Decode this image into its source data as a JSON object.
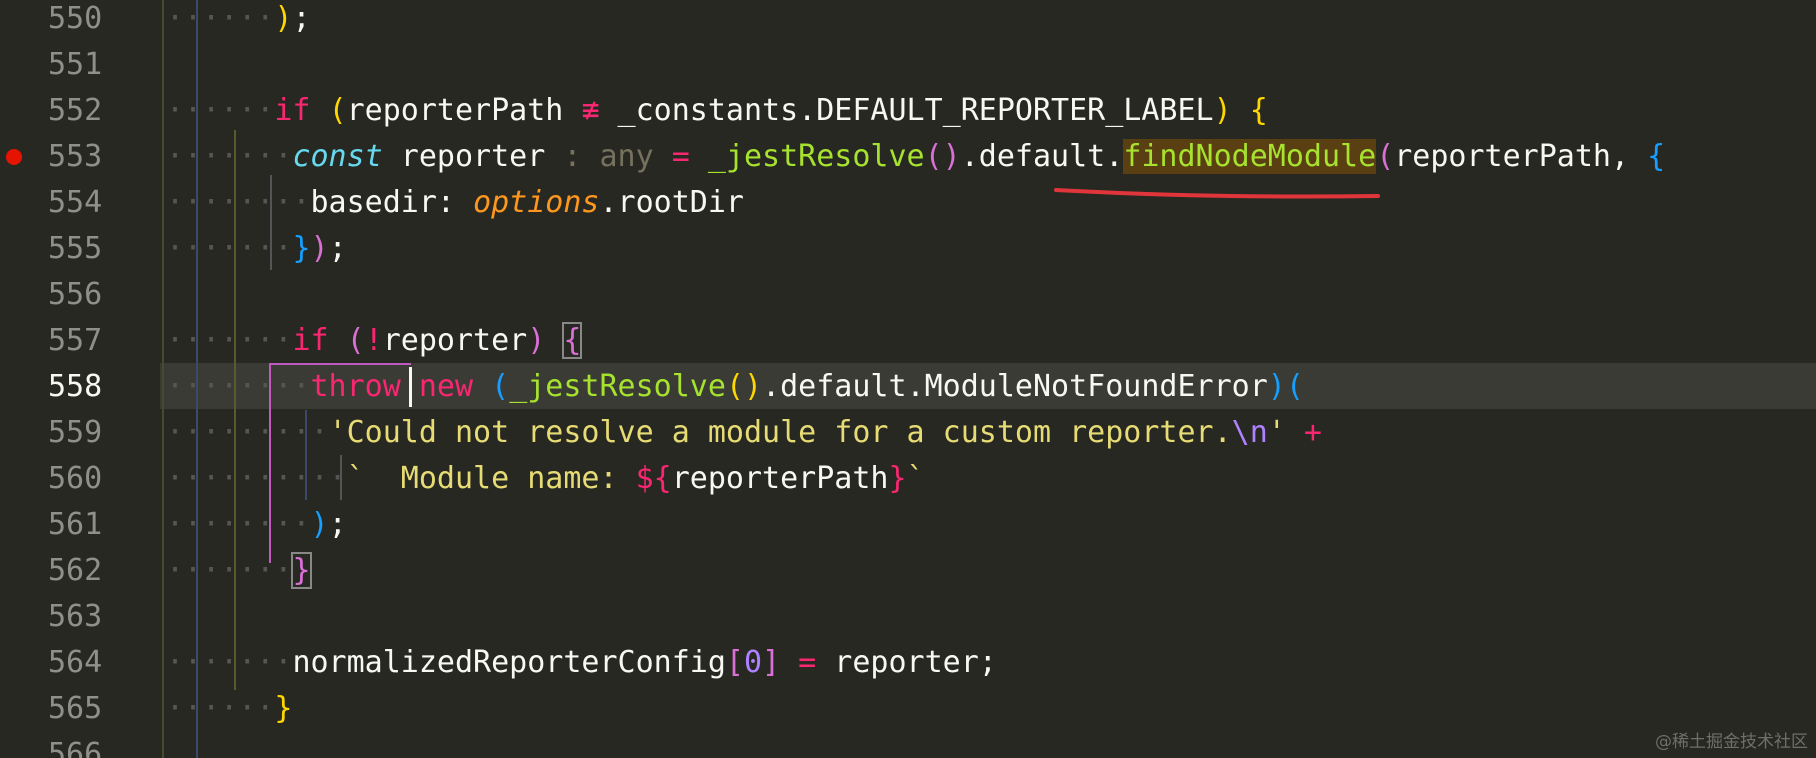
{
  "lines": [
    {
      "number": "550",
      "indent": "······",
      "tokens": [
        [
          "b1",
          ")"
        ],
        [
          "plain",
          ";"
        ]
      ]
    },
    {
      "number": "551",
      "indent": "",
      "tokens": []
    },
    {
      "number": "552",
      "indent": "······",
      "tokens": [
        [
          "kw",
          "if"
        ],
        [
          "plain",
          " "
        ],
        [
          "b1",
          "("
        ],
        [
          "plain",
          "reporterPath "
        ],
        [
          "kw",
          "≢"
        ],
        [
          "plain",
          " _constants.DEFAULT_REPORTER_LABEL"
        ],
        [
          "b1",
          ")"
        ],
        [
          "plain",
          " "
        ],
        [
          "b1",
          "{"
        ]
      ]
    },
    {
      "number": "553",
      "indent": "·······",
      "tokens": [
        [
          "st",
          "const"
        ],
        [
          "plain",
          " reporter "
        ],
        [
          "dim",
          ": any"
        ],
        [
          "plain",
          " "
        ],
        [
          "kw",
          "="
        ],
        [
          "plain",
          " "
        ],
        [
          "fn",
          "_jestResolve"
        ],
        [
          "b2",
          "()"
        ],
        [
          "plain",
          ".default."
        ],
        [
          "fn hl-find",
          "findNodeModule"
        ],
        [
          "b2",
          "("
        ],
        [
          "plain",
          "reporterPath, "
        ],
        [
          "b3",
          "{"
        ]
      ]
    },
    {
      "number": "554",
      "indent": "········",
      "tokens": [
        [
          "plain",
          "basedir: "
        ],
        [
          "arg",
          "options"
        ],
        [
          "plain",
          ".rootDir"
        ]
      ]
    },
    {
      "number": "555",
      "indent": "·······",
      "tokens": [
        [
          "b3",
          "}"
        ],
        [
          "b2",
          ")"
        ],
        [
          "plain",
          ";"
        ]
      ]
    },
    {
      "number": "556",
      "indent": "",
      "tokens": []
    },
    {
      "number": "557",
      "indent": "·······",
      "tokens": [
        [
          "kw",
          "if"
        ],
        [
          "plain",
          " "
        ],
        [
          "b2",
          "("
        ],
        [
          "kw",
          "!"
        ],
        [
          "plain",
          "reporter"
        ],
        [
          "b2",
          ")"
        ],
        [
          "plain",
          " "
        ],
        [
          "b2 box",
          "{"
        ]
      ]
    },
    {
      "number": "558",
      "indent": "········",
      "tokens": [
        [
          "kw",
          "throw"
        ],
        [
          "plain",
          " "
        ],
        [
          "kw",
          "new"
        ],
        [
          "plain",
          " "
        ],
        [
          "b3",
          "("
        ],
        [
          "fn",
          "_jestResolve"
        ],
        [
          "b1",
          "()"
        ],
        [
          "plain",
          ".default.ModuleNotFoundError"
        ],
        [
          "b3",
          ")("
        ]
      ]
    },
    {
      "number": "559",
      "indent": "·········",
      "tokens": [
        [
          "str",
          "'Could not resolve a module for a custom reporter."
        ],
        [
          "num",
          "\\n"
        ],
        [
          "str",
          "'"
        ],
        [
          "plain",
          " "
        ],
        [
          "kw",
          "+"
        ]
      ]
    },
    {
      "number": "560",
      "indent": "··········",
      "tokens": [
        [
          "str",
          "`  Module name: "
        ],
        [
          "kw",
          "${"
        ],
        [
          "plain",
          "reporterPath"
        ],
        [
          "kw",
          "}"
        ],
        [
          "str",
          "`"
        ]
      ]
    },
    {
      "number": "561",
      "indent": "········",
      "tokens": [
        [
          "b3",
          ")"
        ],
        [
          "plain",
          ";"
        ]
      ]
    },
    {
      "number": "562",
      "indent": "·······",
      "tokens": [
        [
          "b2 box",
          "}"
        ]
      ]
    },
    {
      "number": "563",
      "indent": "",
      "tokens": []
    },
    {
      "number": "564",
      "indent": "·······",
      "tokens": [
        [
          "plain",
          "normalizedReporterConfig"
        ],
        [
          "b2",
          "["
        ],
        [
          "num",
          "0"
        ],
        [
          "b2",
          "]"
        ],
        [
          "plain",
          " "
        ],
        [
          "kw",
          "="
        ],
        [
          "plain",
          " reporter;"
        ]
      ]
    },
    {
      "number": "565",
      "indent": "······",
      "tokens": [
        [
          "b1",
          "}"
        ]
      ]
    },
    {
      "number": "566",
      "indent": "",
      "tokens": []
    }
  ],
  "breakpoint_line": "553",
  "active_line": "558",
  "watermark": "@稀土掘金技术社区"
}
